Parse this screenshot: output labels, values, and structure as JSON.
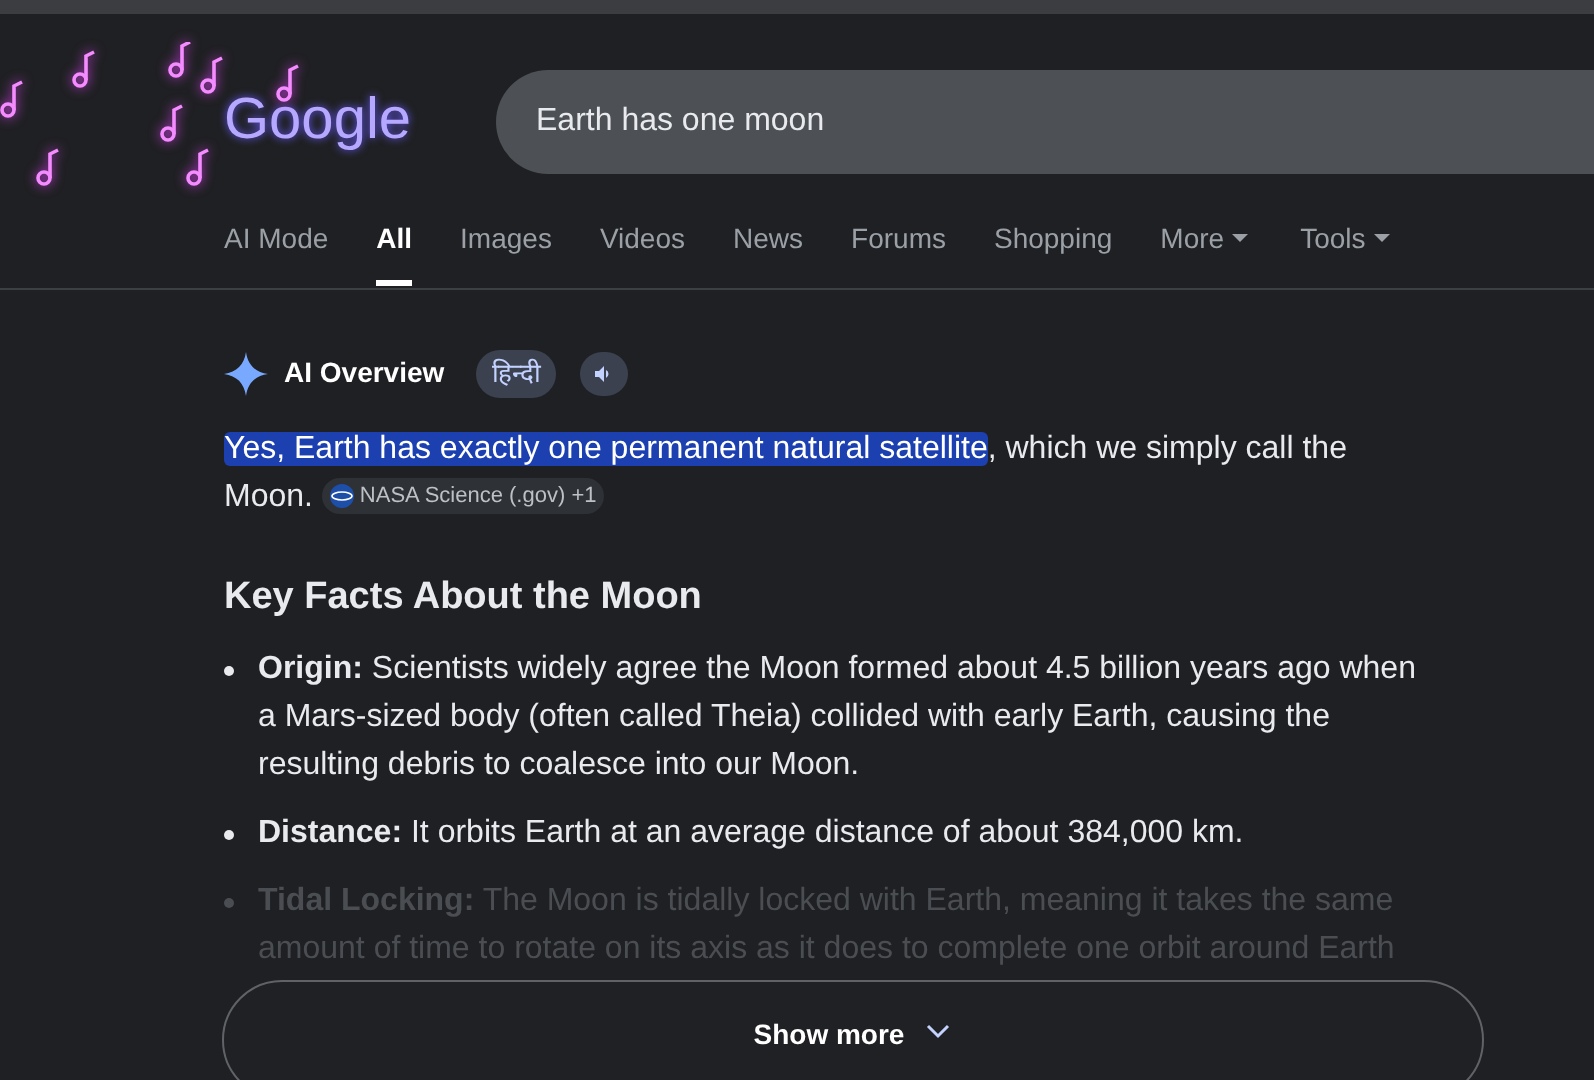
{
  "logo": {
    "text": "Google"
  },
  "search": {
    "value": "Earth has one moon"
  },
  "tabs": [
    {
      "label": "AI Mode",
      "selected": false,
      "menu": false
    },
    {
      "label": "All",
      "selected": true,
      "menu": false
    },
    {
      "label": "Images",
      "selected": false,
      "menu": false
    },
    {
      "label": "Videos",
      "selected": false,
      "menu": false
    },
    {
      "label": "News",
      "selected": false,
      "menu": false
    },
    {
      "label": "Forums",
      "selected": false,
      "menu": false
    },
    {
      "label": "Shopping",
      "selected": false,
      "menu": false
    },
    {
      "label": "More",
      "selected": false,
      "menu": true
    },
    {
      "label": "Tools",
      "selected": false,
      "menu": true
    }
  ],
  "ai_overview": {
    "title": "AI Overview",
    "language_chip": "हिन्दी",
    "answer": {
      "highlighted": "Yes, Earth has exactly one permanent natural satellite",
      "rest": ", which we simply call the Moon.",
      "source": "NASA Science (.gov) +1"
    },
    "heading": "Key Facts About the Moon",
    "facts": [
      {
        "label": "Origin:",
        "text": "Scientists widely agree the Moon formed about 4.5 billion years ago when a Mars-sized body (often called Theia) collided with early Earth, causing the resulting debris to coalesce into our Moon.",
        "faded": false
      },
      {
        "label": "Distance:",
        "text": "It orbits Earth at an average distance of about 384,000 km.",
        "faded": false
      },
      {
        "label": "Tidal Locking:",
        "text": "The Moon is tidally locked with Earth, meaning it takes the same amount of time to rotate on its axis as it does to complete one orbit around Earth",
        "faded": true
      }
    ],
    "show_more": "Show more"
  }
}
